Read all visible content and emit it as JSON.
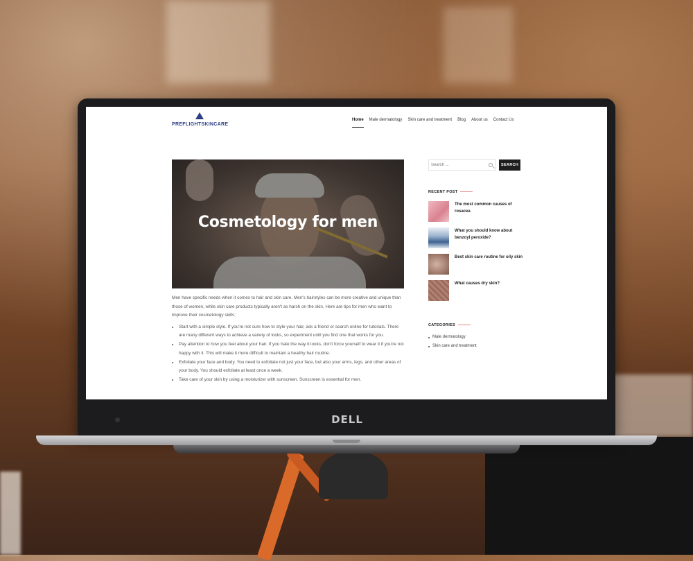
{
  "site": {
    "logo_text": "PREFLIGHTSKINCARE",
    "nav": [
      {
        "label": "Home",
        "active": true
      },
      {
        "label": "Male dermatology",
        "active": false
      },
      {
        "label": "Skin care and treatment",
        "active": false
      },
      {
        "label": "Blog",
        "active": false
      },
      {
        "label": "About us",
        "active": false
      },
      {
        "label": "Contact Us",
        "active": false
      }
    ]
  },
  "hero": {
    "title": "Cosmetology for men"
  },
  "article": {
    "intro": "Men have specific needs when it comes to hair and skin care. Men's hairstyles can be more creative and unique than those of women, while skin care products typically aren't as harsh on the skin. Here are tips for men who want to improve their cosmetology skills:",
    "tips": [
      "Start with a simple style. If you're not sure how to style your hair, ask a friend or search online for tutorials. There are many different ways to achieve a variety of looks, so experiment until you find one that works for you.",
      "Pay attention to how you feel about your hair. If you hate the way it looks, don't force yourself to wear it if you're not happy with it. This will make it more difficult to maintain a healthy hair routine.",
      "Exfoliate your face and body. You need to exfoliate not just your face, but also your arms, legs, and other areas of your body. You should exfoliate at least once a week.",
      "Take care of your skin by using a moisturizer with sunscreen. Sunscreen is essential for men."
    ]
  },
  "sidebar": {
    "search": {
      "placeholder": "Search ...",
      "button_label": "SEARCH"
    },
    "recent_title": "RECENT POST",
    "recent_posts": [
      {
        "title": "The most common causes of rosacea",
        "thumb_color": "#e7a3ae"
      },
      {
        "title": "What you should know about benzoyl peroxide?",
        "thumb_color": "#5a7ea8"
      },
      {
        "title": "Best skin care routine for oily skin",
        "thumb_color": "#b08a7d"
      },
      {
        "title": "What causes dry skin?",
        "thumb_color": "#a5776a"
      }
    ],
    "categories_title": "CATEGORIES",
    "categories": [
      "Male dermatology",
      "Skin care and treatment"
    ]
  },
  "device": {
    "brand": "DELL"
  }
}
